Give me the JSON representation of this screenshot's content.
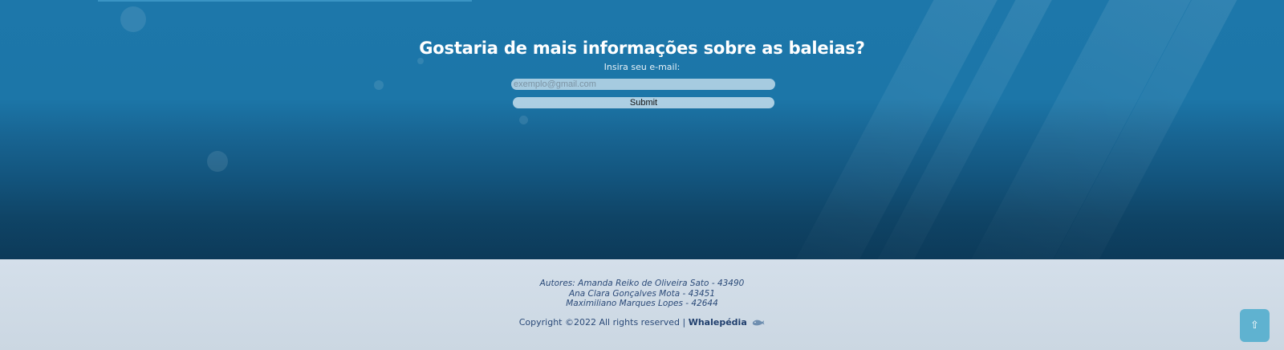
{
  "newsletter": {
    "title": "Gostaria de mais informações sobre as baleias?",
    "email_label": "Insira seu e-mail:",
    "email_placeholder": "exemplo@gmail.com",
    "email_value": "",
    "submit_label": "Submit"
  },
  "footer": {
    "authors": [
      "Autores: Amanda Reiko de Oliveira Sato - 43490",
      "Ana Clara Gonçalves Mota - 43451",
      "Maximiliano Marques Lopes - 42644"
    ],
    "copyright": "Copyright ©2022 All rights reserved |",
    "brand": "Whalepédia",
    "brand_icon": "whale-icon"
  },
  "back_to_top": {
    "icon": "arrow-up-icon",
    "glyph": "⇧"
  },
  "colors": {
    "ocean_top": "#1d77aa",
    "ocean_bottom": "#0c3a59",
    "footer_bg": "#d4dfea",
    "footer_text": "#2b4a78",
    "button_bg": "#5fb2d0"
  }
}
